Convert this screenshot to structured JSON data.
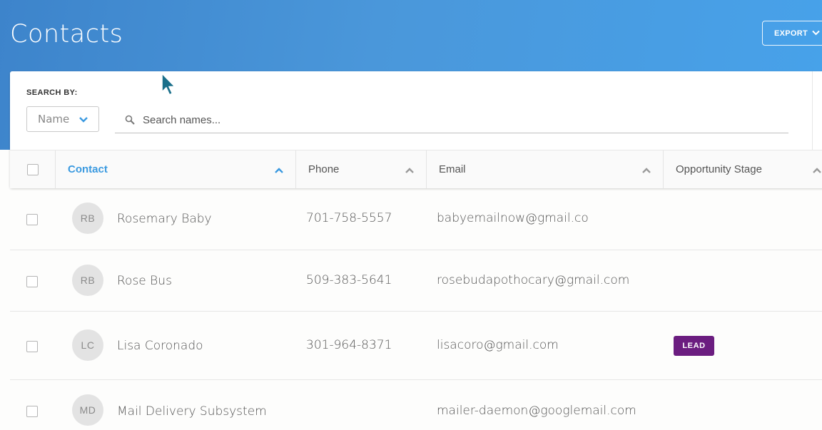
{
  "header": {
    "title": "Contacts",
    "export_label": "EXPORT"
  },
  "search": {
    "search_by_label": "SEARCH BY:",
    "field_selected": "Name",
    "placeholder": "Search names..."
  },
  "table": {
    "columns": [
      {
        "label": "Contact",
        "sorted": true
      },
      {
        "label": "Phone"
      },
      {
        "label": "Email"
      },
      {
        "label": "Opportunity Stage"
      }
    ],
    "rows": [
      {
        "initials": "RB",
        "name": "Rosemary Baby",
        "phone": "701-758-5557",
        "email": "babyemailnow@gmail.co",
        "stage": ""
      },
      {
        "initials": "RB",
        "name": "Rose Bus",
        "phone": "509-383-5641",
        "email": "rosebudapothocary@gmail.com",
        "stage": ""
      },
      {
        "initials": "LC",
        "name": "Lisa Coronado",
        "phone": "301-964-8371",
        "email": "lisacoro@gmail.com",
        "stage": "LEAD"
      },
      {
        "initials": "MD",
        "name": "Mail Delivery Subsystem",
        "phone": "",
        "email": "mailer-daemon@googlemail.com",
        "stage": ""
      }
    ]
  },
  "colors": {
    "header_gradient_start": "#3d84cb",
    "header_gradient_end": "#47a2ea",
    "accent": "#3b9ae0",
    "lead_badge": "#6b1d80"
  }
}
